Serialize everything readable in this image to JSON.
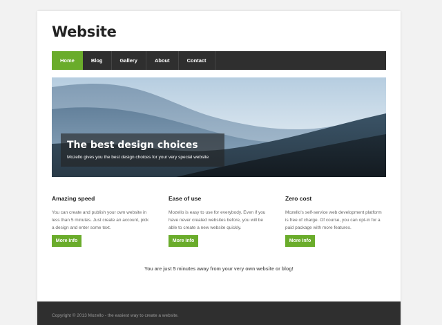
{
  "site": {
    "title": "Website"
  },
  "nav": {
    "items": [
      {
        "label": "Home",
        "active": true
      },
      {
        "label": "Blog"
      },
      {
        "label": "Gallery"
      },
      {
        "label": "About"
      },
      {
        "label": "Contact"
      }
    ]
  },
  "hero": {
    "title": "The best design choices",
    "subtitle": "Mozello gives you the best design choices for your very special website"
  },
  "features": [
    {
      "title": "Amazing speed",
      "text": "You can create and publish your own website in less than 5 minutes. Just create an account, pick a design and enter some text.",
      "button": "More Info"
    },
    {
      "title": "Ease of use",
      "text": "Mozello is easy to use for everybody. Even if you have never created websites before, you will be able to create a new website quickly.",
      "button": "More Info"
    },
    {
      "title": "Zero cost",
      "text": "Mozello's self-service web development platform is free of charge. Of course, you can opt-in for a paid package with more features.",
      "button": "More Info"
    }
  ],
  "cta": {
    "text": "You are just 5 minutes away from your very own website or blog!"
  },
  "footer": {
    "text": "Copyright © 2013 Mozello - the easiest way to create a website."
  },
  "colors": {
    "accent": "#6aac2b",
    "nav_bg": "#2f2f2f",
    "footer_bg": "#2f2f2f"
  }
}
